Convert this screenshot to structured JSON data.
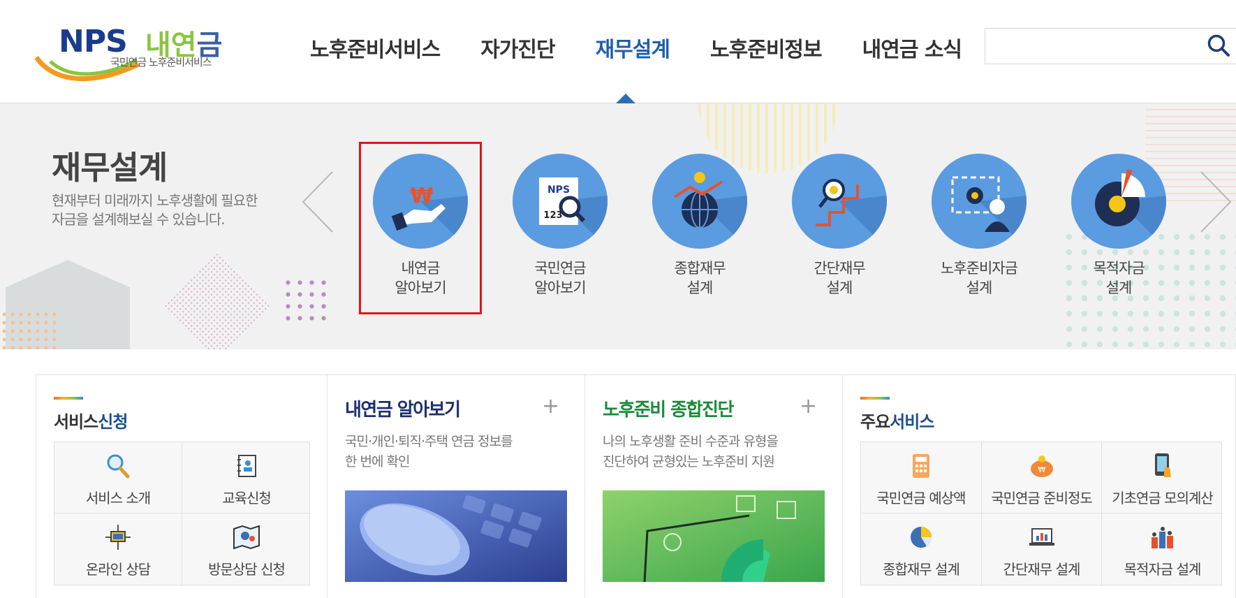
{
  "brand": {
    "logo_nps": "NPS",
    "logo_my_a": "내연",
    "logo_my_b": "금",
    "logo_sub": "국민연금 노후준비서비스"
  },
  "nav": {
    "items": [
      {
        "label": "노후준비서비스"
      },
      {
        "label": "자가진단"
      },
      {
        "label": "재무설계"
      },
      {
        "label": "노후준비정보"
      },
      {
        "label": "내연금 소식"
      }
    ],
    "active": "재무설계"
  },
  "search": {
    "placeholder": "",
    "value": ""
  },
  "visual": {
    "title": "재무설계",
    "desc_line1": "현재부터 미래까지 노후생활에 필요한",
    "desc_line2": "자금을 설계해보실 수 있습니다.",
    "slides": [
      {
        "line1": "내연금",
        "line2": "알아보기",
        "icon": "hand-money-icon"
      },
      {
        "line1": "국민연금",
        "line2": "알아보기",
        "icon": "nps-magnifier-icon"
      },
      {
        "line1": "종합재무",
        "line2": "설계",
        "icon": "globe-growth-icon"
      },
      {
        "line1": "간단재무",
        "line2": "설계",
        "icon": "stairs-search-icon"
      },
      {
        "line1": "노후준비자금",
        "line2": "설계",
        "icon": "gear-person-icon"
      },
      {
        "line1": "목적자금",
        "line2": "설계",
        "icon": "pie-coin-icon"
      }
    ],
    "selected_slide": "내연금 알아보기"
  },
  "service_request": {
    "title_a": "서비스",
    "title_b": "신청",
    "items": [
      {
        "label": "서비스 소개",
        "icon": "magnifier-icon"
      },
      {
        "label": "교육신청",
        "icon": "notebook-icon"
      },
      {
        "label": "온라인 상담",
        "icon": "network-monitor-icon"
      },
      {
        "label": "방문상담 신청",
        "icon": "map-icon"
      }
    ]
  },
  "card1": {
    "title": "내연금 알아보기",
    "plus": "+",
    "desc1": "국민·개인·퇴직·주택 연금 정보를",
    "desc2": "한 번에 확인",
    "color": "#1d2f6e"
  },
  "card2": {
    "title": "노후준비 종합진단",
    "plus": "+",
    "desc1": "나의 노후생활 준비 수준과 유형을",
    "desc2": "진단하여 균형있는 노후준비 지원",
    "color": "#1b8a3a"
  },
  "main_services": {
    "title_a": "주요",
    "title_b": "서비스",
    "items": [
      {
        "label": "국민연금 예상액",
        "icon": "calculator-icon"
      },
      {
        "label": "국민연금 준비정도",
        "icon": "piggy-bank-icon"
      },
      {
        "label": "기초연금 모의계산",
        "icon": "phone-tap-icon"
      },
      {
        "label": "종합재무 설계",
        "icon": "pie-chart-icon"
      },
      {
        "label": "간단재무 설계",
        "icon": "laptop-chart-icon"
      },
      {
        "label": "목적자금 설계",
        "icon": "bar-people-icon"
      }
    ]
  }
}
